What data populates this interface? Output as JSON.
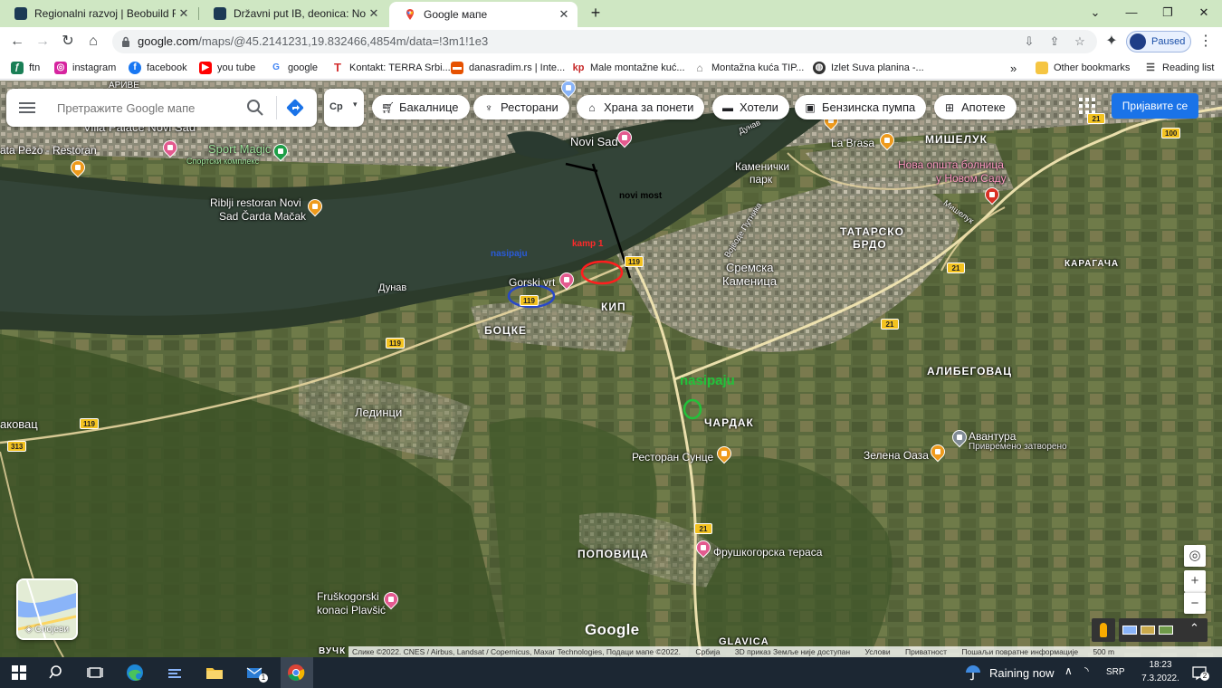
{
  "browser": {
    "tabs": [
      {
        "label": "Regionalni razvoj | Beobuild Foru",
        "favicon_color": "#1c3a55"
      },
      {
        "label": "Državni put IB, deonica: Novi Sad",
        "favicon_color": "#1c3a55"
      },
      {
        "label": "Google мапе",
        "favicon_color": "#34a853"
      }
    ],
    "close_glyph": "✕",
    "newtab_glyph": "+",
    "url_host": "google.com",
    "url_path": "/maps/@45.2141231,19.832466,4854m/data=!3m1!1e3",
    "profile_label": "Paused",
    "bookmarks": [
      {
        "label": "ftn",
        "icon": "f-icon",
        "color": "#1a7f56"
      },
      {
        "label": "instagram",
        "icon": "instagram-icon",
        "color": "#d6249f"
      },
      {
        "label": "facebook",
        "icon": "facebook-icon",
        "color": "#1877f2"
      },
      {
        "label": "you tube",
        "icon": "youtube-icon",
        "color": "#ff0000"
      },
      {
        "label": "google",
        "icon": "google-icon",
        "color": "#4285f4"
      },
      {
        "label": "Kontakt: TERRA Srbi...",
        "icon": "terra-icon",
        "color": "#d32f2f"
      },
      {
        "label": "danasradim.rs | Inte...",
        "icon": "danasradim-icon",
        "color": "#e65100"
      },
      {
        "label": "Male montažne kuć...",
        "icon": "kp-icon",
        "color": "#c62828"
      },
      {
        "label": "Montažna kuća TIP...",
        "icon": "house-icon",
        "color": "#777777"
      },
      {
        "label": "Izlet Suva planina -...",
        "icon": "globe-icon",
        "color": "#333333"
      }
    ],
    "bookmarks_overflow": "»",
    "other_bookmarks": "Other bookmarks",
    "reading_list": "Reading list"
  },
  "maps": {
    "search_placeholder": "Претражите Google мапе",
    "traffic_label": "Cр",
    "chips": [
      {
        "label": "Бакалнице",
        "icon": "cart-icon"
      },
      {
        "label": "Ресторани",
        "icon": "restaurant-icon"
      },
      {
        "label": "Храна за понети",
        "icon": "takeout-icon"
      },
      {
        "label": "Хотели",
        "icon": "hotel-icon"
      },
      {
        "label": "Бензинска пумпа",
        "icon": "gas-station-icon"
      },
      {
        "label": "Апотеке",
        "icon": "pharmacy-icon"
      }
    ],
    "signin": "Пријавите се",
    "layers_label": "Слојеви",
    "logo": "Google",
    "labels": {
      "novi_sad": "Novi Sad",
      "villa_palace": "Villa Palace Novi Sad",
      "peso": "ata Pežo - Restoran",
      "sport_magic": "Sport Magic",
      "sport_magic_sub": "Спортски комплекс",
      "riblji_1": "Riblji restoran Novi",
      "riblji_2": "Sad Čarda Mačak",
      "dunav_river": "Дунав",
      "dunav_road": "Дунав",
      "kamenicki_1": "Каменички",
      "kamenicki_2": "парк",
      "la_brasa": "La Brasa",
      "miseluk": "МИШЕЛУК",
      "bolnica_1": "Нова општа болница",
      "bolnica_2": "у Новом Саду",
      "tatarsko_1": "ТАТАРСКО",
      "tatarsko_2": "БРДО",
      "karagaca": "КАРАГАЧА",
      "sremska_1": "Сремска",
      "sremska_2": "Каменица",
      "kip": "КИП",
      "bocke": "БОЦКЕ",
      "gorskivrt": "Gorski vrt",
      "alibegovac": "АЛИБЕГОВАЦ",
      "cardak": "ЧАРДАК",
      "avantura": "Авантура",
      "avantura_sub": "Привремено затворено",
      "zelena_oaza": "Зелена Оаза",
      "restoran_sunce": "Ресторан Сунце",
      "ledinci": "Лединци",
      "akovac": "аковац",
      "popovica": "ПОПОВИЦА",
      "fruskogorska": "Фрушкогорска тераса",
      "konaci_1": "Fruškogorski",
      "konaci_2": "konaci Plavšić",
      "glavica": "GLAVICA",
      "vuck": "ВУЧК",
      "ivosa": "Војводе Путника",
      "miseluk_st": "Мишелук",
      "arive": "АРИВЕ",
      "ann_novi_most": "novi most",
      "ann_kamp1": "kamp 1",
      "ann_nasipaju_blue": "nasipaju",
      "ann_nasipaju_green": "nasipaju"
    },
    "shields": {
      "r119a": "119",
      "r119b": "119",
      "r119c": "119",
      "r119d": "119",
      "r21a": "21",
      "r21b": "21",
      "r21c": "21",
      "r21d": "21",
      "r100": "100",
      "r313": "313"
    },
    "attribution": [
      "Слике ©2022. CNES / Airbus, Landsat / Copernicus, Maxar Technologies, Подаци мапе ©2022.",
      "Србија",
      "3D приказ Земље није доступан",
      "Услови",
      "Приватност",
      "Пошаљи повратне информације",
      "500 m"
    ]
  },
  "taskbar": {
    "weather": "Raining now",
    "lang": "SRP",
    "time": "18:23",
    "date": "7.3.2022.",
    "mail_badge": "1",
    "notif_badge": "2"
  }
}
